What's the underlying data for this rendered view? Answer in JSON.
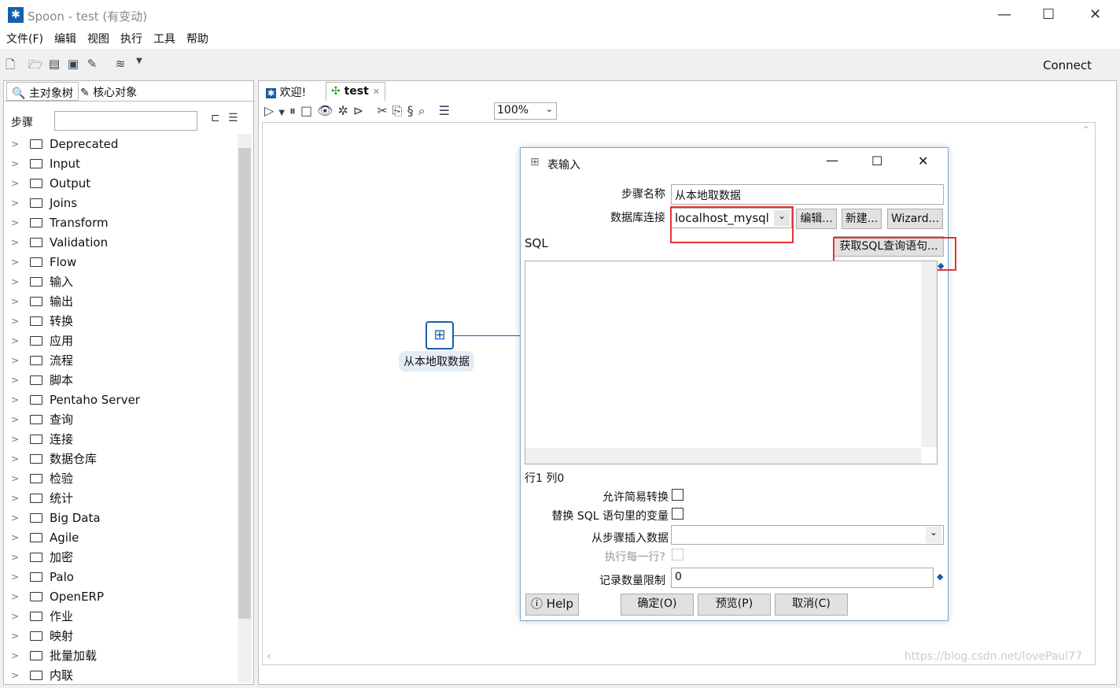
{
  "window": {
    "title": "Spoon - test (有变动)",
    "minimize": "—",
    "maximize": "☐",
    "close": "✕"
  },
  "menu": [
    "文件(F)",
    "编辑",
    "视图",
    "执行",
    "工具",
    "帮助"
  ],
  "toolbar": {
    "connect": "Connect"
  },
  "left_panel": {
    "tabs": [
      "主对象树",
      "核心对象"
    ],
    "search_label": "步骤",
    "search_value": "",
    "items": [
      "Deprecated",
      "Input",
      "Output",
      "Joins",
      "Transform",
      "Validation",
      "Flow",
      "输入",
      "输出",
      "转换",
      "应用",
      "流程",
      "脚本",
      "Pentaho Server",
      "查询",
      "连接",
      "数据仓库",
      "检验",
      "统计",
      "Big Data",
      "Agile",
      "加密",
      "Palo",
      "OpenERP",
      "作业",
      "映射",
      "批量加载",
      "内联"
    ]
  },
  "editor": {
    "tabs": [
      "欢迎!",
      "test"
    ],
    "zoom": "100%",
    "step_label": "从本地取数据"
  },
  "dialog": {
    "title": "表输入",
    "step_name_label": "步骤名称",
    "step_name": "从本地取数据",
    "db_label": "数据库连接",
    "db_value": "localhost_mysql",
    "edit": "编辑...",
    "new": "新建...",
    "wizard": "Wizard...",
    "sql_label": "SQL",
    "get_sql": "获取SQL查询语句...",
    "sql_text": "",
    "position": "行1 列0",
    "lazy_label": "允许简易转换",
    "replace_label": "替换 SQL 语句里的变量",
    "insert_label": "从步骤插入数据",
    "insert_value": "",
    "each_row_label": "执行每一行?",
    "limit_label": "记录数量限制",
    "limit_value": "0",
    "help": "Help",
    "ok": "确定(O)",
    "preview": "预览(P)",
    "cancel": "取消(C)"
  },
  "watermark": "https://blog.csdn.net/lovePaul77",
  "colors": {
    "highlight": "#e53333",
    "accent": "#1560a8"
  }
}
